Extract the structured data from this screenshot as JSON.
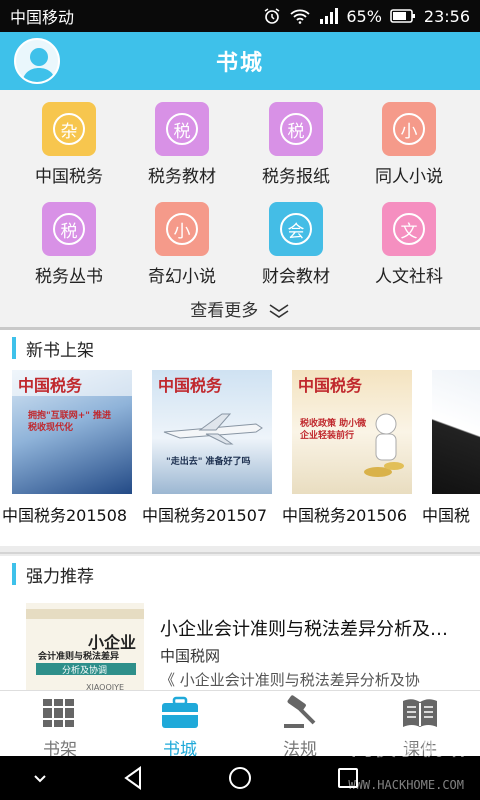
{
  "status": {
    "carrier": "中国移动",
    "battery": "65%",
    "time": "23:56"
  },
  "header": {
    "title": "书城"
  },
  "categories": [
    {
      "label": "中国税务",
      "glyph": "杂",
      "color": "#f7c64e"
    },
    {
      "label": "税务教材",
      "glyph": "税",
      "color": "#d891e6"
    },
    {
      "label": "税务报纸",
      "glyph": "税",
      "color": "#d891e6"
    },
    {
      "label": "同人小说",
      "glyph": "小",
      "color": "#f59a8a"
    },
    {
      "label": "税务丛书",
      "glyph": "税",
      "color": "#d891e6"
    },
    {
      "label": "奇幻小说",
      "glyph": "小",
      "color": "#f59a8a"
    },
    {
      "label": "财会教材",
      "glyph": "会",
      "color": "#44bde6"
    },
    {
      "label": "人文社科",
      "glyph": "文",
      "color": "#f58fc0"
    }
  ],
  "more_label": "查看更多",
  "new_books": {
    "title": "新书上架",
    "items": [
      {
        "title": "中国税务201508",
        "cover_text": "拥抱\"互联网+\" 推进税收现代化"
      },
      {
        "title": "中国税务201507",
        "cover_text": "\"走出去\" 准备好了吗"
      },
      {
        "title": "中国税务201506",
        "cover_text": "税收政策 助小微企业轻装前行"
      },
      {
        "title": "中国税",
        "cover_text": ""
      }
    ],
    "masthead": "中国税务"
  },
  "recommend": {
    "title": "强力推荐",
    "item": {
      "title": "小企业会计准则与税法差异分析及…",
      "source": "中国税网",
      "desc": "《 小企业会计准则与税法差异分析及协",
      "cover_title": "小企业",
      "cover_sub": "会计准则与税法差异",
      "cover_band": "分析及协调",
      "cover_foot": "XIAOQIYE"
    }
  },
  "tabs": [
    {
      "label": "书架"
    },
    {
      "label": "书城"
    },
    {
      "label": "法规"
    },
    {
      "label": "课件"
    }
  ],
  "watermark": {
    "name": "网侠手机站",
    "url": "WWW.HACKHOME.COM"
  }
}
